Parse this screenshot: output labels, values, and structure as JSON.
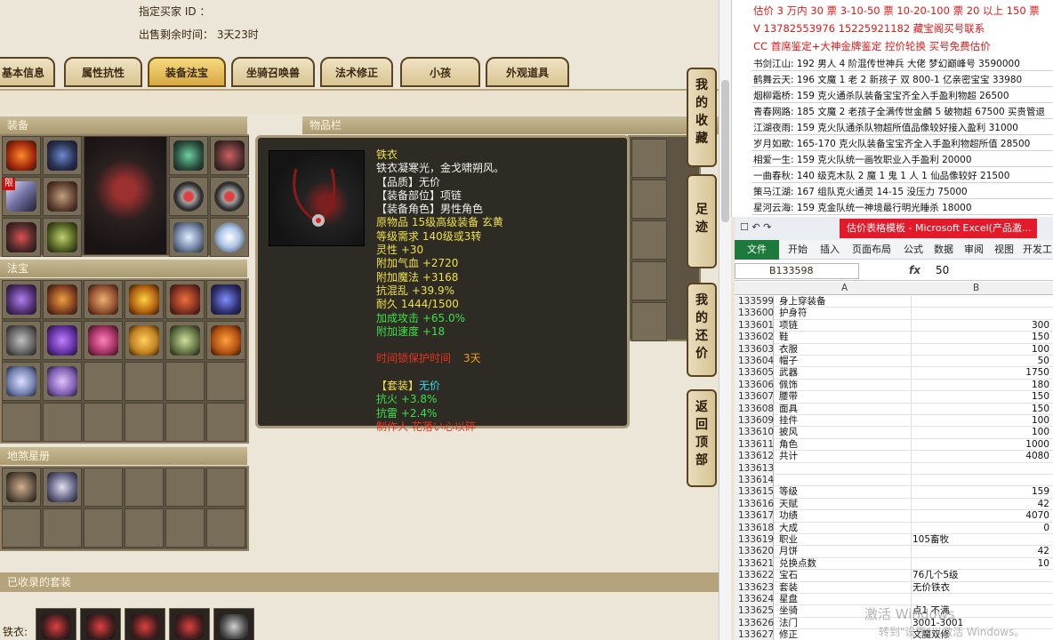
{
  "sale": {
    "buyer_label": "指定买家 ID ：",
    "time_label": "出售剩余时间：",
    "time_value": "3天23时"
  },
  "tabs": [
    "基本信息",
    "属性抗性",
    "装备法宝",
    "坐骑召唤兽",
    "法术修正",
    "小孩",
    "外观道具"
  ],
  "active_tab": 2,
  "panels": {
    "equip": "装备",
    "fabao": "法宝",
    "map": "地煞星册",
    "itembar": "物品栏",
    "suits": "已收录的套装",
    "suit_label": "铁衣:"
  },
  "badge_limited": "限",
  "tooltip": {
    "name": "铁衣",
    "lines": [
      {
        "text": "铁衣凝寒光，金戈啸朔风。",
        "color": "w"
      },
      {
        "text": "【品质】无价",
        "color": "w"
      },
      {
        "text": "【装备部位】项链",
        "color": "w"
      },
      {
        "text": "【装备角色】男性角色",
        "color": "w"
      },
      {
        "text": "原物品 15级高级装备 玄黄",
        "color": "y"
      },
      {
        "text": "等级需求 140级或3转",
        "color": "y"
      },
      {
        "text": "灵性 +30",
        "color": "y"
      },
      {
        "text": "附加气血 +2720",
        "color": "y"
      },
      {
        "text": "附加魔法 +3168",
        "color": "y"
      },
      {
        "text": "抗混乱 +39.9%",
        "color": "y"
      },
      {
        "text": "耐久 1444/1500",
        "color": "y"
      },
      {
        "text": "加成攻击 +65.0%",
        "color": "g"
      },
      {
        "text": "附加速度 +18",
        "color": "g"
      },
      {
        "text": "",
        "color": "w"
      },
      {
        "text": "时间锁保护时间",
        "color": "r",
        "extra": "3天"
      },
      {
        "text": "",
        "color": "w"
      },
      {
        "text": "【套装】",
        "color": "y",
        "extra_c": "无价"
      },
      {
        "text": "抗火 +3.8%",
        "color": "g"
      },
      {
        "text": "抗雷 +2.4%",
        "color": "g"
      },
      {
        "text": "制作人 花落い心以碎",
        "color": "r"
      }
    ]
  },
  "side_buttons": [
    "我的收藏",
    "足迹",
    "我的还价",
    "返回顶部"
  ],
  "notes": {
    "red_lines": [
      "估价 3 万内 30 票    3-10-50 票    10-20-100 票    20 以上 150 票",
      "V 13782553976     15225921182    藏宝阁买号联系",
      "CC 首席鉴定+大神金牌鉴定  控价轮换  买号免费估价"
    ],
    "lines": [
      "书剑江山: 192 男人 4 阶混传世神兵 大佬 梦幻巅峰号 3590000",
      "鹤舞云天: 196 文魔 1 老 2 新孩子 双 800-1 亿亲密宝宝 33980",
      "烟柳霜桥: 159 克火通杀队装备宝宝齐全入手盈利物超 26500",
      "青春网路: 185 文魔 2 老孩子全满传世金麟 5 破物超 67500 买贵管退",
      "江湖夜雨: 159 克火队通杀队物超所值品像较好接入盈利 31000",
      "岁月如歌: 165-170 克火队装备宝宝齐全入手盈利物超所值 28500",
      "相爱一生: 159 克火队统一画牧职业入手盈利 20000",
      "一曲春秋: 140 级克木队 2 魔 1 鬼 1 人 1 仙品像较好 21500",
      "策马江湖: 167 组队克火通灵 14-15 没压力 75000",
      "星河云海: 159 克金队统一神境最行明光睡杀 18000"
    ]
  },
  "excel": {
    "quick_access": "☐ ↶ ↷",
    "window_title": "估价表格模板 - Microsoft Excel(产品激...",
    "ribbon": [
      "文件",
      "开始",
      "插入",
      "页面布局",
      "公式",
      "数据",
      "审阅",
      "视图",
      "开发工"
    ],
    "name_box": "B133598",
    "fx": "fx",
    "formula_value": "50",
    "col_a": "A",
    "col_b": "B",
    "rows": [
      {
        "n": "133599",
        "a": "身上穿装备",
        "b": ""
      },
      {
        "n": "133600",
        "a": "护身符",
        "b": ""
      },
      {
        "n": "133601",
        "a": "项链",
        "b": "300"
      },
      {
        "n": "133602",
        "a": "鞋",
        "b": "150"
      },
      {
        "n": "133603",
        "a": "衣服",
        "b": "100"
      },
      {
        "n": "133604",
        "a": "帽子",
        "b": "50"
      },
      {
        "n": "133605",
        "a": "武器",
        "b": "1750"
      },
      {
        "n": "133606",
        "a": "佩饰",
        "b": "180"
      },
      {
        "n": "133607",
        "a": "腰带",
        "b": "150"
      },
      {
        "n": "133608",
        "a": "面具",
        "b": "150"
      },
      {
        "n": "133609",
        "a": "挂件",
        "b": "100"
      },
      {
        "n": "133610",
        "a": "披风",
        "b": "100"
      },
      {
        "n": "133611",
        "a": "角色",
        "b": "1000"
      },
      {
        "n": "133612",
        "a": "共计",
        "b": "4080"
      },
      {
        "n": "133613",
        "a": "",
        "b": ""
      },
      {
        "n": "133614",
        "a": "",
        "b": ""
      },
      {
        "n": "133615",
        "a": "等级",
        "b": "159"
      },
      {
        "n": "133616",
        "a": "天赋",
        "b": "42"
      },
      {
        "n": "133617",
        "a": "功绩",
        "b": "4070"
      },
      {
        "n": "133618",
        "a": "大成",
        "b": "0"
      },
      {
        "n": "133619",
        "a": "职业",
        "b": "105畜牧",
        "txt": true
      },
      {
        "n": "133620",
        "a": "月饼",
        "b": "42"
      },
      {
        "n": "133621",
        "a": "兑换点数",
        "b": "10"
      },
      {
        "n": "133622",
        "a": "宝石",
        "b": "76几个5级",
        "txt": true
      },
      {
        "n": "133623",
        "a": "套装",
        "b": "无价铁衣",
        "txt": true
      },
      {
        "n": "133624",
        "a": "星盘",
        "b": "",
        "txt": true
      },
      {
        "n": "133625",
        "a": "坐骑",
        "b": "点1 不满",
        "txt": true
      },
      {
        "n": "133626",
        "a": "法门",
        "b": "3001-3001",
        "txt": true
      },
      {
        "n": "133627",
        "a": "修正",
        "b": "文魔双修",
        "txt": true
      }
    ],
    "watermark": "激活 Windows",
    "watermark2": "转到\"设置\"以激活 Windows。"
  },
  "colors": {
    "accent_red": "#e01818",
    "excel_green": "#1e7a3c",
    "tab_active": "#d8a943"
  }
}
